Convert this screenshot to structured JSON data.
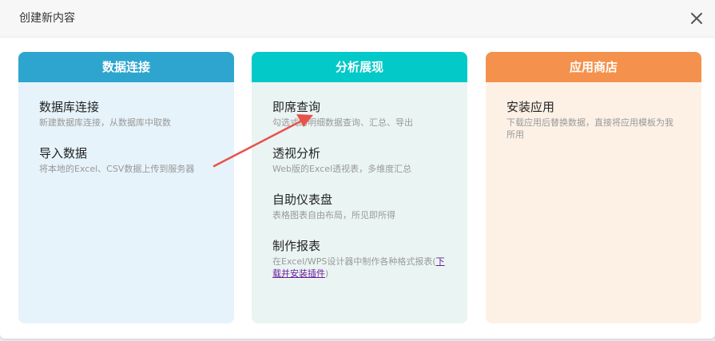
{
  "dialog": {
    "title": "创建新内容"
  },
  "colors": {
    "card1_head": "#2ea5cf",
    "card2_head": "#03c9c9",
    "card3_head": "#f4924d",
    "arrow": "#e8534c"
  },
  "cards": [
    {
      "title": "数据连接",
      "items": [
        {
          "name": "数据库连接",
          "desc": "新建数据库连接，从数据库中取数"
        },
        {
          "name": "导入数据",
          "desc": "将本地的Excel、CSV数据上传到服务器"
        }
      ]
    },
    {
      "title": "分析展现",
      "items": [
        {
          "name": "即席查询",
          "desc": "勾选式的明细数据查询、汇总、导出"
        },
        {
          "name": "透视分析",
          "desc": "Web版的Excel透视表，多维度汇总"
        },
        {
          "name": "自助仪表盘",
          "desc": "表格图表自由布局，所见即所得"
        },
        {
          "name": "制作报表",
          "desc": "在Excel/WPS设计器中制作各种格式报表(",
          "link": "下载并安装插件",
          "desc_end": ")"
        }
      ]
    },
    {
      "title": "应用商店",
      "items": [
        {
          "name": "安装应用",
          "desc": "下载应用后替换数据，直接将应用模板为我所用"
        }
      ]
    }
  ]
}
